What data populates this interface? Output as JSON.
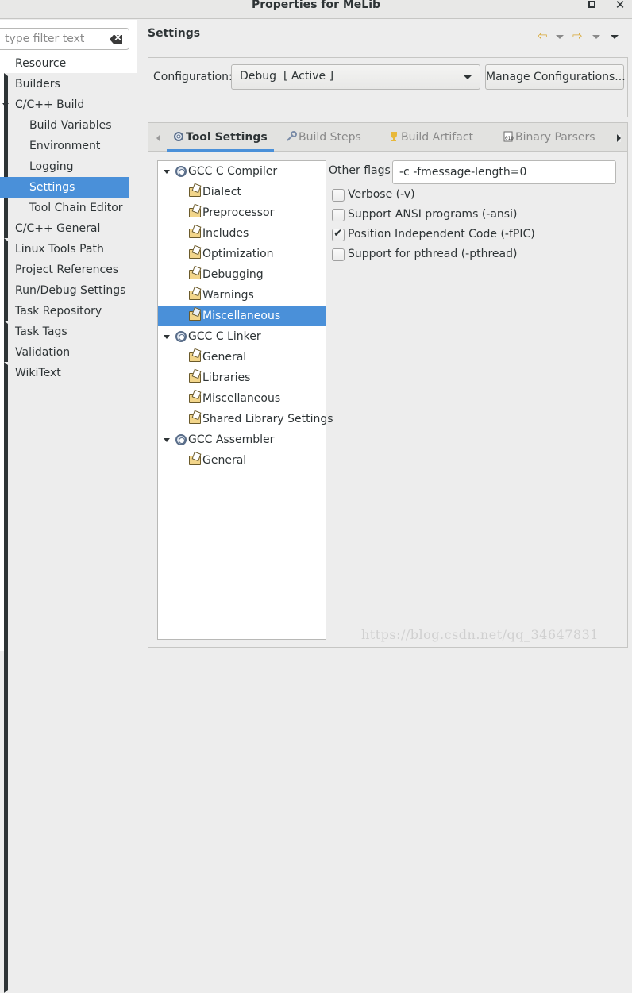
{
  "window": {
    "title": "Properties for MeLib"
  },
  "filter": {
    "placeholder": "type filter text"
  },
  "nav": {
    "items": [
      {
        "label": "Resource",
        "arrow": "right",
        "indent": 0
      },
      {
        "label": "Builders",
        "arrow": "",
        "indent": 0
      },
      {
        "label": "C/C++ Build",
        "arrow": "down",
        "indent": 0
      },
      {
        "label": "Build Variables",
        "arrow": "",
        "indent": 1
      },
      {
        "label": "Environment",
        "arrow": "",
        "indent": 1
      },
      {
        "label": "Logging",
        "arrow": "",
        "indent": 1
      },
      {
        "label": "Settings",
        "arrow": "",
        "indent": 1,
        "selected": true
      },
      {
        "label": "Tool Chain Editor",
        "arrow": "",
        "indent": 1
      },
      {
        "label": "C/C++ General",
        "arrow": "right",
        "indent": 0
      },
      {
        "label": "Linux Tools Path",
        "arrow": "",
        "indent": 0
      },
      {
        "label": "Project References",
        "arrow": "",
        "indent": 0
      },
      {
        "label": "Run/Debug Settings",
        "arrow": "",
        "indent": 0
      },
      {
        "label": "Task Repository",
        "arrow": "right",
        "indent": 0
      },
      {
        "label": "Task Tags",
        "arrow": "",
        "indent": 0
      },
      {
        "label": "Validation",
        "arrow": "right",
        "indent": 0
      },
      {
        "label": "WikiText",
        "arrow": "",
        "indent": 0
      }
    ]
  },
  "settings": {
    "title": "Settings",
    "config_label": "Configuration:",
    "config_value": "Debug  [ Active ]",
    "manage_label": "Manage Configurations..."
  },
  "tabs": [
    {
      "label": "Tool Settings",
      "icon": "tool-settings-icon",
      "active": true
    },
    {
      "label": "Build Steps",
      "icon": "build-steps-icon"
    },
    {
      "label": "Build Artifact",
      "icon": "trophy-icon"
    },
    {
      "label": "Binary Parsers",
      "icon": "binary-icon"
    }
  ],
  "tool_tree": [
    {
      "label": "GCC C Compiler",
      "type": "tool"
    },
    {
      "label": "Dialect",
      "type": "option"
    },
    {
      "label": "Preprocessor",
      "type": "option"
    },
    {
      "label": "Includes",
      "type": "option"
    },
    {
      "label": "Optimization",
      "type": "option"
    },
    {
      "label": "Debugging",
      "type": "option"
    },
    {
      "label": "Warnings",
      "type": "option"
    },
    {
      "label": "Miscellaneous",
      "type": "option",
      "selected": true
    },
    {
      "label": "GCC C Linker",
      "type": "tool"
    },
    {
      "label": "General",
      "type": "option"
    },
    {
      "label": "Libraries",
      "type": "option"
    },
    {
      "label": "Miscellaneous",
      "type": "option"
    },
    {
      "label": "Shared Library Settings",
      "type": "option"
    },
    {
      "label": "GCC Assembler",
      "type": "tool"
    },
    {
      "label": "General",
      "type": "option"
    }
  ],
  "options": {
    "other_flags_label": "Other flags",
    "other_flags_value": "-c -fmessage-length=0",
    "checkboxes": [
      {
        "label": "Verbose (-v)",
        "checked": false
      },
      {
        "label": "Support ANSI programs (-ansi)",
        "checked": false
      },
      {
        "label": "Position Independent Code (-fPIC)",
        "checked": true
      },
      {
        "label": "Support for pthread (-pthread)",
        "checked": false
      }
    ]
  },
  "watermark": "https://blog.csdn.net/qq_34647831",
  "colors": {
    "selection": "#4a90d9",
    "text": "#2e3436",
    "background": "#ededed"
  }
}
